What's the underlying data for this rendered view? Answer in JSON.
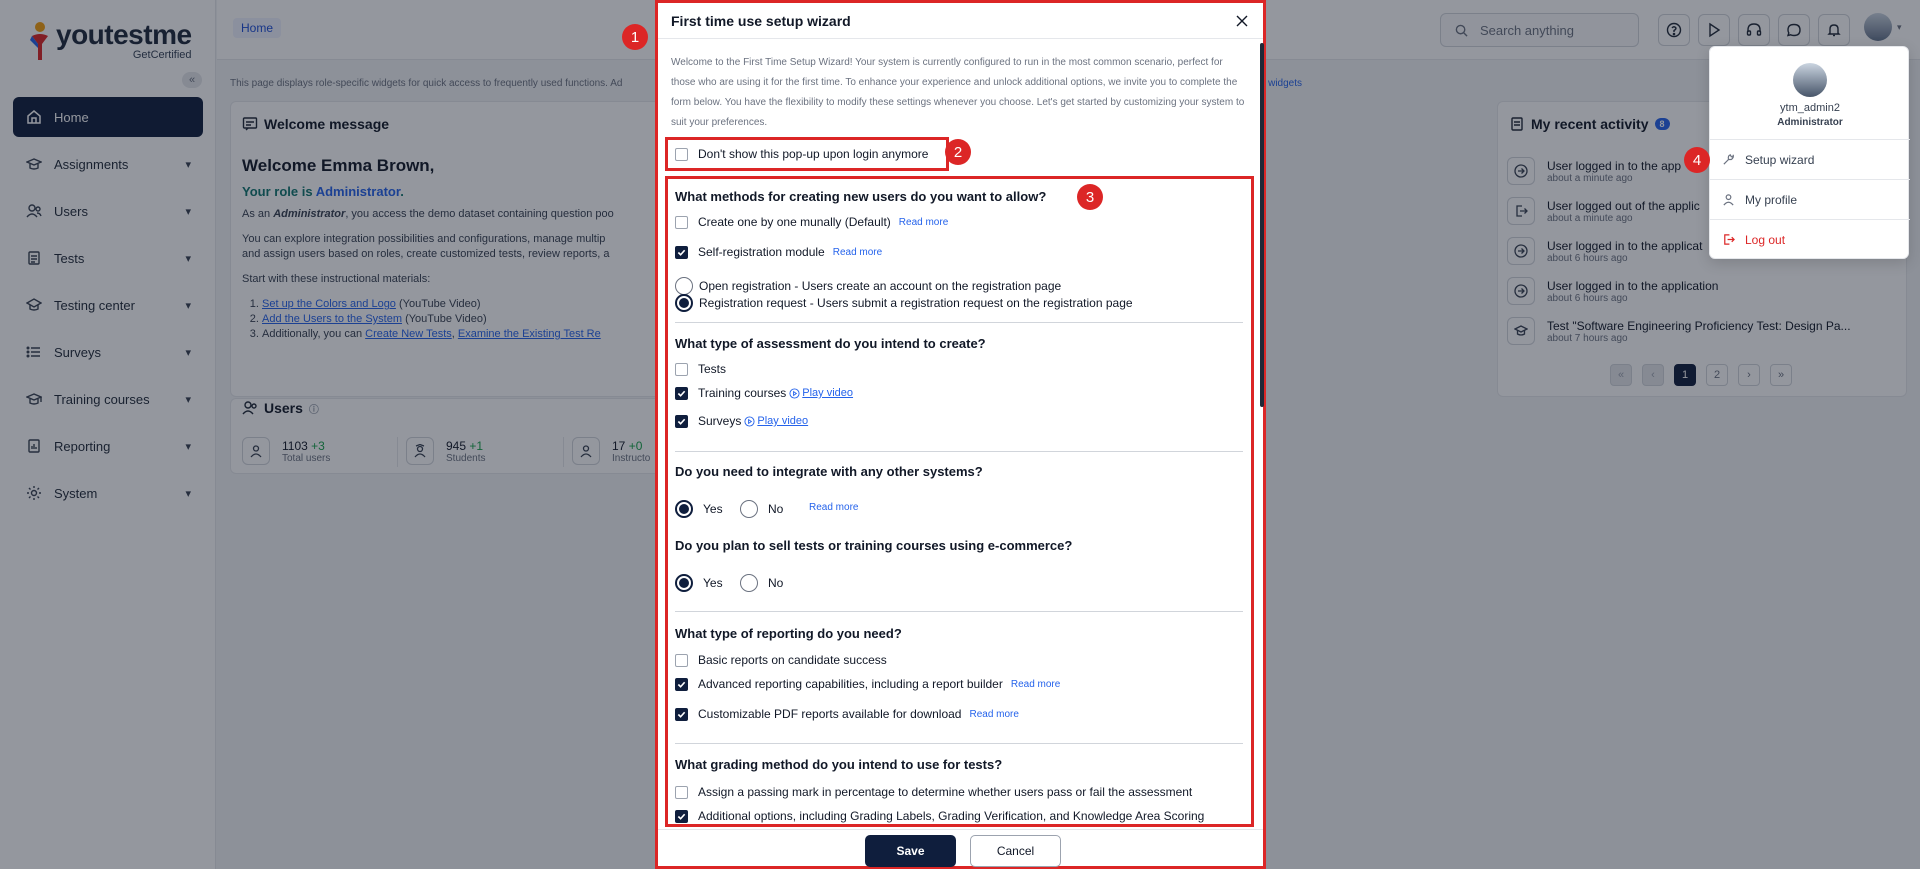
{
  "app": {
    "logo_text": "youtestme",
    "logo_sub": "GetCertified",
    "collapse_glyph": "«"
  },
  "sidebar": {
    "items": [
      {
        "label": "Home",
        "icon": "home-icon",
        "active": true
      },
      {
        "label": "Assignments",
        "icon": "graduation-cap-icon"
      },
      {
        "label": "Users",
        "icon": "users-icon"
      },
      {
        "label": "Tests",
        "icon": "document-icon"
      },
      {
        "label": "Testing center",
        "icon": "building-icon"
      },
      {
        "label": "Surveys",
        "icon": "list-icon"
      },
      {
        "label": "Training courses",
        "icon": "mortarboard-icon"
      },
      {
        "label": "Reporting",
        "icon": "report-icon"
      },
      {
        "label": "System",
        "icon": "gear-icon"
      }
    ]
  },
  "topbar": {
    "breadcrumb": "Home",
    "search_placeholder": "Search anything",
    "icons": [
      "help-icon",
      "play-icon",
      "headset-icon",
      "chat-icon",
      "bell-icon"
    ]
  },
  "page": {
    "hint": "This page displays role-specific widgets for quick access to frequently used functions. Ad",
    "hint_link": "r widgets",
    "welcome": {
      "title": "Welcome message",
      "heading": "Welcome Emma Brown,",
      "role_prefix": "Your role is ",
      "role": "Administrator",
      "role_suffix": ".",
      "p1_pre": "As an ",
      "p1_role": "Administrator",
      "p1_post": ", you access the demo dataset containing question poo",
      "p2a": "You can explore integration possibilities and configurations, manage multip",
      "p2b": "and assign users based on roles, create customized tests, review reports, a",
      "p3": "Start with these instructional materials:",
      "l1_link": "Set up the Colors and Logo",
      "l1_rest": " (YouTube Video)",
      "l2_link": "Add the Users to the System",
      "l2_rest": " (YouTube Video)",
      "l3_pre": "Additionally, you can ",
      "l3_link1": "Create New Tests",
      "l3_sep": ", ",
      "l3_link2": "Examine the Existing Test Re"
    },
    "users_widget": {
      "title": "Users",
      "stats": [
        {
          "value": "1103",
          "delta": "+3",
          "label": "Total users"
        },
        {
          "value": "945",
          "delta": "+1",
          "label": "Students"
        },
        {
          "value": "17",
          "delta": "+0",
          "label": "Instructo"
        }
      ]
    },
    "activity": {
      "title": "My recent activity",
      "badge": "8",
      "items": [
        {
          "text": "User logged in to the app",
          "time": "about a minute ago"
        },
        {
          "text": "User logged out of the applic",
          "time": "about a minute ago"
        },
        {
          "text": "User logged in to the applicat",
          "time": "about 6 hours ago"
        },
        {
          "text": "User logged in to the application",
          "time": "about 6 hours ago"
        },
        {
          "text": "Test \"Software Engineering Proficiency Test: Design Pa...",
          "time": "about 7 hours ago"
        }
      ],
      "pages": [
        "«",
        "‹",
        "1",
        "2",
        "›",
        "»"
      ]
    }
  },
  "user_menu": {
    "username": "ytm_admin2",
    "role": "Administrator",
    "items": [
      "Setup wizard",
      "My profile",
      "Log out"
    ]
  },
  "wizard": {
    "title": "First time use setup wizard",
    "intro": "Welcome to the First Time Setup Wizard! Your system is currently configured to run in the most common scenario, perfect for those who are using it for the first time. To enhance your experience and unlock additional options, we invite you to complete the form below. You have the flexibility to modify these settings whenever you choose. Let's get started by customizing your system to suit your preferences.",
    "dont_show": "Don't show this pop-up upon login anymore",
    "q1": {
      "title": "What methods for creating new users do you want to allow?",
      "opt1": "Create one by one munally (Default)",
      "opt2": "Self-registration module",
      "r1": "Open registration - Users create an account on the registration page",
      "r2": "Registration request - Users submit a registration request on the registration page"
    },
    "q2": {
      "title": "What type of assessment do you intend to create?",
      "opt1": "Tests",
      "opt2": "Training courses",
      "opt3": "Surveys"
    },
    "q3": {
      "title": "Do you need to integrate with any other systems?",
      "yes": "Yes",
      "no": "No"
    },
    "q4": {
      "title": "Do you plan to sell tests or training courses using e-commerce?",
      "yes": "Yes",
      "no": "No"
    },
    "q5": {
      "title": "What type of reporting do you need?",
      "opt1": "Basic reports on candidate success",
      "opt2": "Advanced reporting capabilities, including a report builder",
      "opt3": "Customizable PDF reports available for download"
    },
    "q6": {
      "title": "What grading method do you intend to use for tests?",
      "opt1": "Assign a passing mark in percentage to determine whether users pass or fail the assessment",
      "opt2": "Additional options, including Grading Labels, Grading Verification, and Knowledge Area Scoring"
    },
    "read_more": "Read more",
    "play_video": "Play video",
    "save": "Save",
    "cancel": "Cancel"
  },
  "markers": [
    "1",
    "2",
    "3",
    "4"
  ],
  "colors": {
    "primary": "#0f1e3d",
    "highlight": "#dc2626",
    "link": "#2563eb"
  }
}
